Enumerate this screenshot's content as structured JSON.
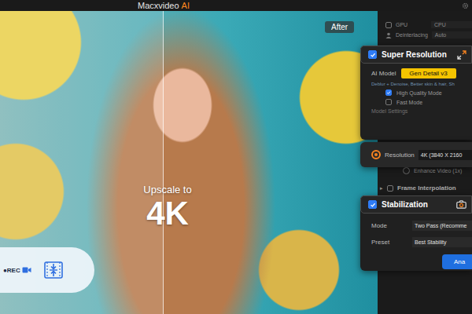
{
  "window": {
    "title": "Macxvideo",
    "title_suffix": "AI"
  },
  "preview": {
    "after_label": "After",
    "caption": "Upscale to",
    "caption_big": "4K"
  },
  "toolbar": {
    "rec_label": "●REC"
  },
  "gpu": {
    "label": "GPU",
    "checked": false,
    "value": "CPU"
  },
  "deinterlacing": {
    "label": "Deinterlacing",
    "value": "Auto"
  },
  "super_resolution": {
    "title": "Super Resolution",
    "checked": true,
    "ai_model_label": "AI Model",
    "ai_model": "Gen Detail v3",
    "description": "Deblur + Denoise, Better skin & hair, Sh",
    "modes": [
      {
        "label": "High Quality Mode",
        "checked": true
      },
      {
        "label": "Fast Mode",
        "checked": false
      }
    ],
    "model_settings": "Model Settings"
  },
  "output_options": [
    {
      "label": "Resolution",
      "selected": true,
      "kind": "card",
      "value": "4K (3840 X 2160"
    },
    {
      "label": "Enhance Video (1x)",
      "selected": false,
      "kind": "plain",
      "value": ""
    }
  ],
  "frame_interpolation": {
    "label": "Frame Interpolation",
    "checked": false,
    "arrow": "▸"
  },
  "stabilization": {
    "title": "Stabilization",
    "checked": true,
    "fields": [
      {
        "label": "Mode",
        "value": "Two Pass (Recomme"
      },
      {
        "label": "Preset",
        "value": "Best Stability"
      }
    ],
    "button": "Ana"
  }
}
